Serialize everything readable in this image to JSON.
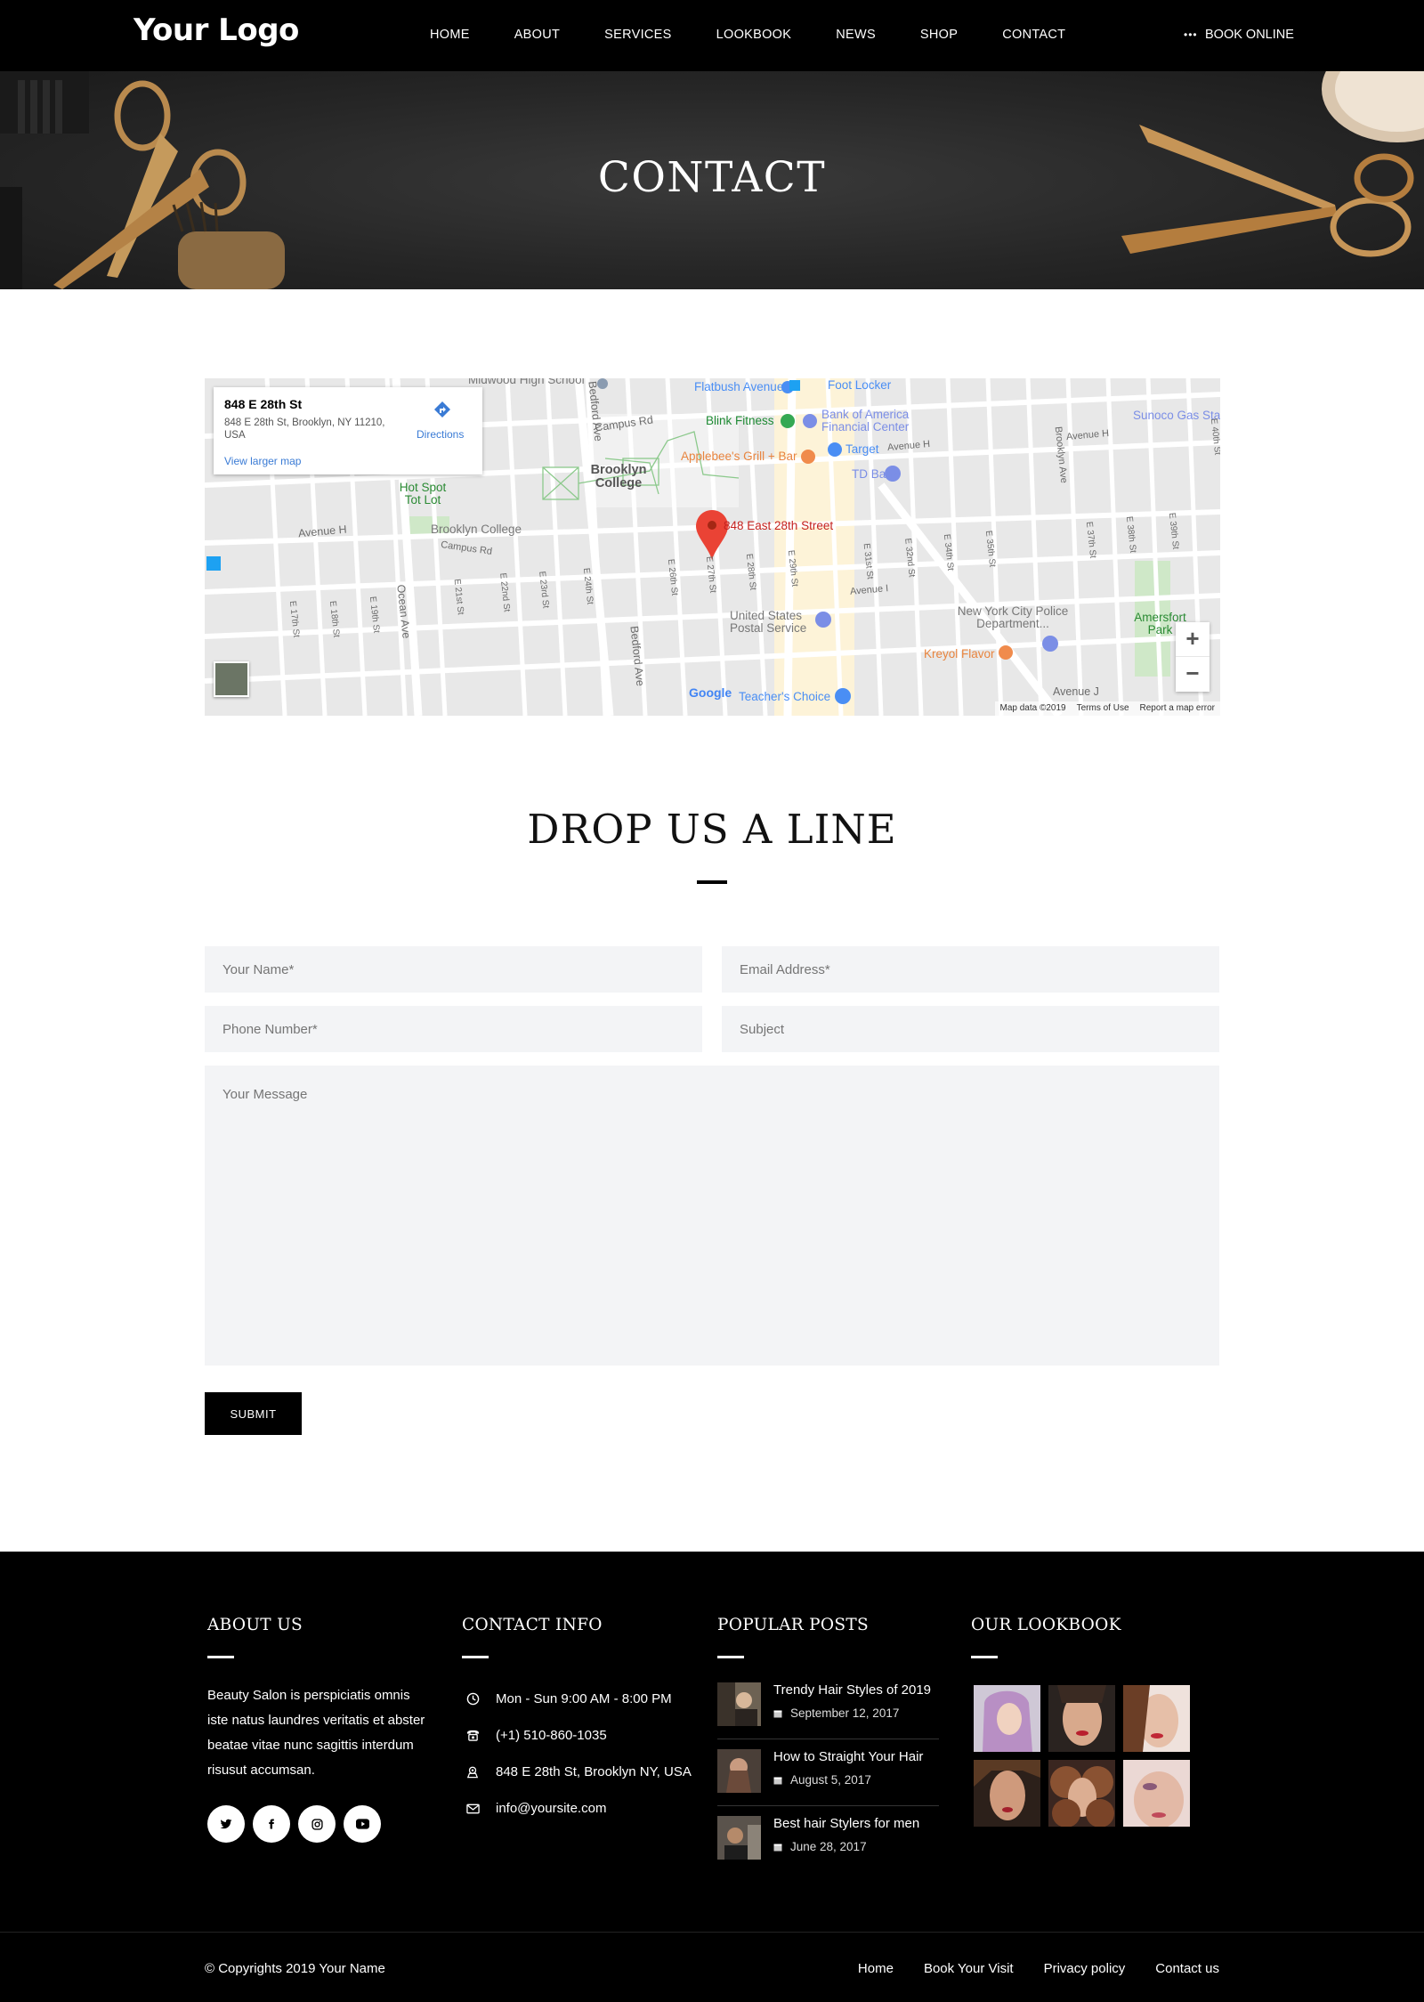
{
  "header": {
    "logo": "Your Logo",
    "nav": [
      "HOME",
      "ABOUT",
      "SERVICES",
      "LOOKBOOK",
      "NEWS",
      "SHOP",
      "CONTACT"
    ],
    "book_online": "BOOK ONLINE"
  },
  "hero": {
    "title": "CONTACT"
  },
  "map": {
    "card_title": "848 E 28th St",
    "card_address": "848 E 28th St, Brooklyn, NY 11210, USA",
    "view_larger": "View larger map",
    "directions": "Directions",
    "pin_label": "848 East 28th Street",
    "zoom_in": "+",
    "zoom_out": "−",
    "google": "Google",
    "footer": [
      "Map data ©2019",
      "Terms of Use",
      "Report a map error"
    ],
    "pois": {
      "midwood": "Midwood High School",
      "flatbush": "Flatbush Avenue",
      "foot_locker": "Foot Locker",
      "blink": "Blink Fitness",
      "boa": "Bank of America Financial Center",
      "sunoco": "Sunoco Gas Sta",
      "applebees": "Applebee's Grill + Bar",
      "target": "Target",
      "td_bank": "TD Bank",
      "brooklyn_college": "Brooklyn College",
      "brooklyn_college_2": "Brooklyn College",
      "hot_spot": "Hot Spot Tot Lot",
      "usps": "United States Postal Service",
      "nypd": "New York City Police Department...",
      "kreyol": "Kreyol Flavor",
      "amersfort": "Amersfort Park",
      "teachers": "Teacher's Choice"
    },
    "streets": [
      "Campus Rd",
      "Avenue H",
      "Bedford Ave",
      "Ocean Ave",
      "Campus Rd",
      "Avenue I",
      "Avenue J",
      "E 17th St",
      "E 18th St",
      "E 19th St",
      "E 21st St",
      "E 22nd St",
      "E 23rd St",
      "E 24th St",
      "E 26th St",
      "E 27th St",
      "E 28th St",
      "E 29th St",
      "E 31st St",
      "E 32nd St",
      "E 34th St",
      "E 35th St",
      "E 37th St",
      "E 38th St",
      "E 39th St",
      "E 40th St",
      "Brooklyn Ave",
      "Bedford Ave",
      "Avenue H",
      "Avenue H"
    ]
  },
  "form": {
    "title": "DROP US A LINE",
    "name_placeholder": "Your Name*",
    "email_placeholder": "Email Address*",
    "phone_placeholder": "Phone Number*",
    "subject_placeholder": "Subject",
    "message_placeholder": "Your Message",
    "submit": "SUBMIT"
  },
  "footer": {
    "about": {
      "heading": "ABOUT US",
      "text": "Beauty Salon is perspiciatis omnis iste natus laundres veritatis et abster beatae vitae nunc sagittis interdum risusut accumsan.",
      "socials": [
        "twitter-icon",
        "facebook-icon",
        "instagram-icon",
        "youtube-icon"
      ]
    },
    "contact": {
      "heading": "CONTACT INFO",
      "hours": "Mon - Sun 9:00 AM - 8:00 PM",
      "phone": "(+1) 510-860-1035",
      "address": "848 E 28th St, Brooklyn NY, USA",
      "email": "info@yoursite.com"
    },
    "posts": {
      "heading": "POPULAR POSTS",
      "items": [
        {
          "title": "Trendy Hair Styles of 2019",
          "date": "September 12, 2017"
        },
        {
          "title": "How to Straight Your Hair",
          "date": "August 5, 2017"
        },
        {
          "title": "Best hair Stylers for men",
          "date": "June 28, 2017"
        }
      ]
    },
    "lookbook": {
      "heading": "OUR LOOKBOOK"
    },
    "copyright": "© Copyrights 2019 Your Name",
    "links": [
      "Home",
      "Book Your Visit",
      "Privacy policy",
      "Contact us"
    ]
  },
  "colors": {
    "accent": "#000000",
    "field_bg": "#f3f4f6",
    "map_pin": "#ea4335"
  }
}
